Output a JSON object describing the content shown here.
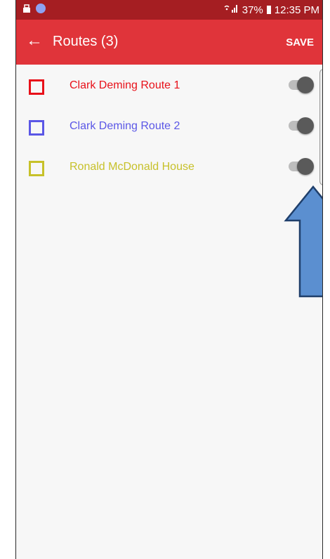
{
  "status_bar": {
    "signal_text": "☷ .∥",
    "battery": "37%",
    "time": "12:35 PM",
    "left_icons": [
      "notification-icon",
      "notification-icon-2"
    ]
  },
  "app_bar": {
    "back_icon": "arrow-left",
    "title": "Routes (3)",
    "save_label": "SAVE"
  },
  "routes": [
    {
      "name": "Clark Deming Route 1",
      "color": "#e8111a",
      "enabled": true
    },
    {
      "name": "Clark Deming Route 2",
      "color": "#5b57e6",
      "enabled": true
    },
    {
      "name": "Ronald McDonald House",
      "color": "#c7c12a",
      "enabled": true
    }
  ],
  "colors": {
    "status_bar": "#a51e22",
    "app_bar": "#e0343a",
    "arrow_fill": "#5b8fd0",
    "arrow_stroke": "#1f3f6b"
  }
}
